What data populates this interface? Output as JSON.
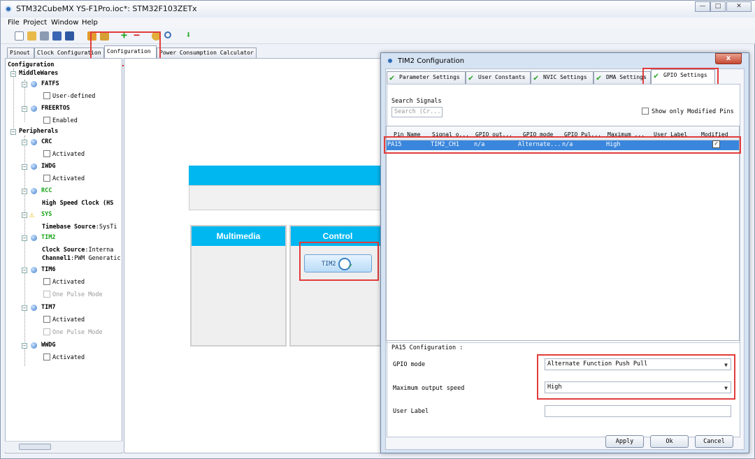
{
  "window": {
    "title": "STM32CubeMX YS-F1Pro.ioc*: STM32F103ZETx",
    "min_label": "—",
    "max_label": "□",
    "close_label": "✕"
  },
  "menu": [
    "File",
    "Project",
    "Window",
    "Help"
  ],
  "main_tabs": [
    "Pinout",
    "Clock Configuration",
    "Configuration",
    "Power Consumption Calculator"
  ],
  "tree": {
    "root": "Configuration",
    "middlewares": "MiddleWares",
    "fatfs": "FATFS",
    "fatfs_opt": "User-defined",
    "freertos": "FREERTOS",
    "freertos_opt": "Enabled",
    "peripherals": "Peripherals",
    "crc": "CRC",
    "activated": "Activated",
    "iwdg": "IWDG",
    "rcc": "RCC",
    "rcc_hsc_label": "High Speed Clock (HS",
    "sys": "SYS",
    "sys_tb_label": "Timebase Source",
    "sys_tb_value": ":SysTi",
    "tim2": "TIM2",
    "tim2_cs_label": "Clock Source",
    "tim2_cs_value": ":Interna",
    "tim2_ch1_label": "Channel1",
    "tim2_ch1_value": ":PWM Generatic",
    "tim6": "TIM6",
    "one_pulse": "One Pulse Mode",
    "tim7": "TIM7",
    "wwdg": "WWDG"
  },
  "canvas": {
    "multimedia": "Multimedia",
    "control": "Control",
    "tim2_button": "TIM2"
  },
  "dialog": {
    "title": "TIM2 Configuration",
    "close": "x",
    "tabs": [
      "Parameter Settings",
      "User Constants",
      "NVIC Settings",
      "DMA Settings",
      "GPIO Settings"
    ],
    "search_label": "Search Signals",
    "search_placeholder": "Search (Cr...",
    "show_modified": "Show only Modified Pins",
    "columns": [
      "Pin Name",
      "Signal o...",
      "GPIO out...",
      "GPIO mode",
      "GPIO Pul...",
      "Maximum ...",
      "User Label",
      "Modified"
    ],
    "row": {
      "pin": "PA15",
      "signal": "TIM2_CH1",
      "gpio_out": "n/a",
      "gpio_mode": "Alternate...",
      "gpio_pull": "n/a",
      "max_speed": "High",
      "user_label": "",
      "modified": "✓"
    },
    "pin_config_title": "PA15 Configuration :",
    "gpio_mode_label": "GPIO mode",
    "gpio_mode_value": "Alternate Function Push Pull",
    "max_speed_label": "Maximum output speed",
    "max_speed_value": "High",
    "user_label_label": "User Label",
    "user_label_value": "",
    "apply": "Apply",
    "ok": "Ok",
    "cancel": "Cancel"
  },
  "colors": {
    "cyan_header": "#00b7f0",
    "selection": "#3a86dc",
    "annotation_red": "#e23c3c",
    "enabled_green": "#19a319"
  },
  "icons": [
    "new-file-icon",
    "open-folder-icon",
    "copy-icon",
    "save-icon",
    "save-all-icon",
    "generate-code-icon",
    "report-icon",
    "add-icon",
    "remove-icon",
    "pin-icon",
    "search-icon",
    "download-icon",
    "check-icon",
    "warning-icon",
    "clock-icon"
  ]
}
